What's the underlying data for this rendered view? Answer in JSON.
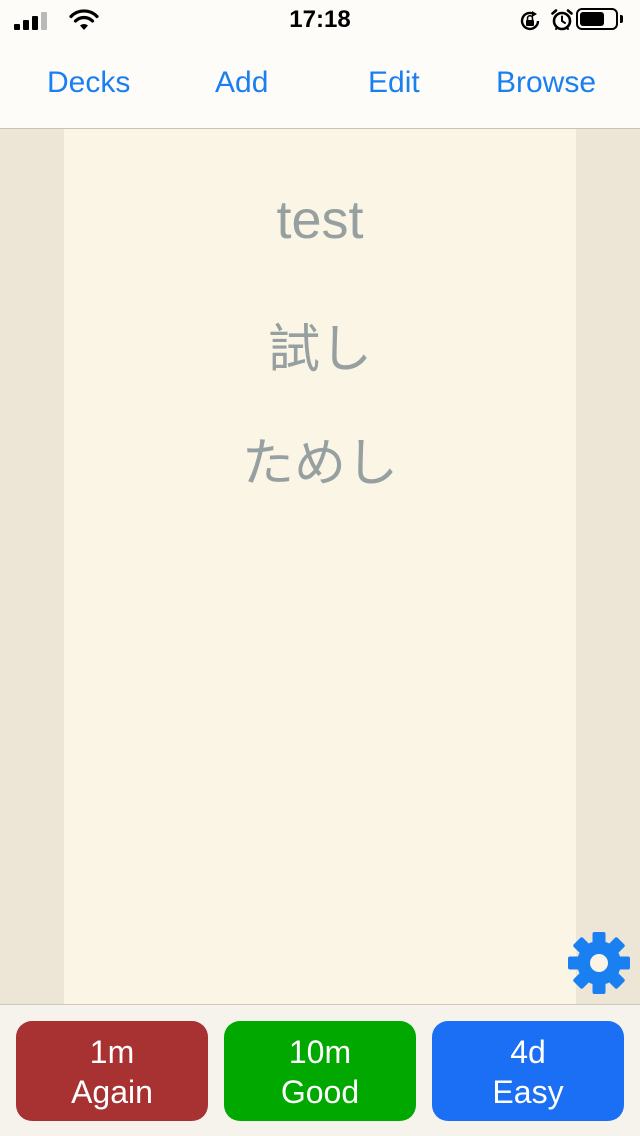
{
  "status_bar": {
    "time": "17:18",
    "icons": [
      "signal-icon",
      "wifi-icon",
      "rotation-lock-icon",
      "alarm-icon",
      "battery-icon"
    ]
  },
  "nav": {
    "decks": "Decks",
    "add": "Add",
    "edit": "Edit",
    "browse": "Browse"
  },
  "card": {
    "front": "test",
    "kanji": "試し",
    "kana": "ためし"
  },
  "answers": {
    "again": {
      "interval": "1m",
      "label": "Again",
      "color": "#a83232"
    },
    "good": {
      "interval": "10m",
      "label": "Good",
      "color": "#00a800"
    },
    "easy": {
      "interval": "4d",
      "label": "Easy",
      "color": "#1a6ff5"
    }
  },
  "colors": {
    "accent": "#1a7ff0",
    "card_background": "#fbf5e6",
    "page_background": "#ede6d6",
    "card_text": "#97a0a0"
  },
  "settings_icon": "gear-icon"
}
